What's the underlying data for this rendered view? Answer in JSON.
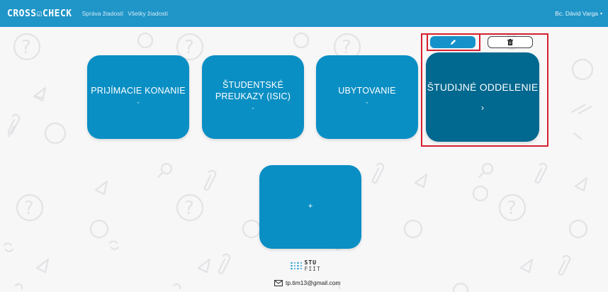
{
  "navbar": {
    "brand": "CROSS☑CHECK",
    "links": [
      "Správa žiadostí",
      "Všetky žiadosti"
    ],
    "user": "Bc. Dávid Varga",
    "user_caret": "▾"
  },
  "actions": {
    "edit_icon": "pencil-icon",
    "delete_icon": "trash-icon"
  },
  "tiles": [
    {
      "label": "PRIJÍMACIE KONANIE",
      "indicator": "ˇ"
    },
    {
      "label": "ŠTUDENTSKÉ PREUKAZY (ISIC)",
      "indicator": "ˇ"
    },
    {
      "label": "UBYTOVANIE",
      "indicator": "ˇ"
    },
    {
      "label": "ŠTUDIJNÉ ODDELENIE",
      "indicator": "›",
      "selected": true
    }
  ],
  "add_tile": {
    "label": "+"
  },
  "footer": {
    "logo_line1": "STU",
    "logo_line2": "FIIT",
    "email": "tp.tim13@gmail.com"
  },
  "colors": {
    "navbar": "#1f95c8",
    "tile": "#0a8fc4",
    "tile_selected": "#01688f",
    "highlight": "#d6202e"
  }
}
